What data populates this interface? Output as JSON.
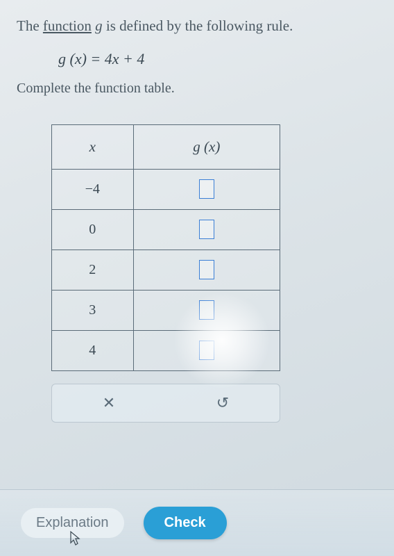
{
  "intro": {
    "prefix": "The ",
    "function_word": "function",
    "mid": " ",
    "g": "g",
    "suffix": " is defined by the following rule."
  },
  "formula": "g(x) = 4x + 4",
  "instruction": "Complete the function table.",
  "table": {
    "header_x": "x",
    "header_gx": "g(x)",
    "rows": [
      {
        "x": "−4"
      },
      {
        "x": "0"
      },
      {
        "x": "2"
      },
      {
        "x": "3"
      },
      {
        "x": "4"
      }
    ]
  },
  "toolbar": {
    "clear": "✕",
    "reset": "↺"
  },
  "footer": {
    "explanation": "Explanation",
    "check": "Check"
  }
}
